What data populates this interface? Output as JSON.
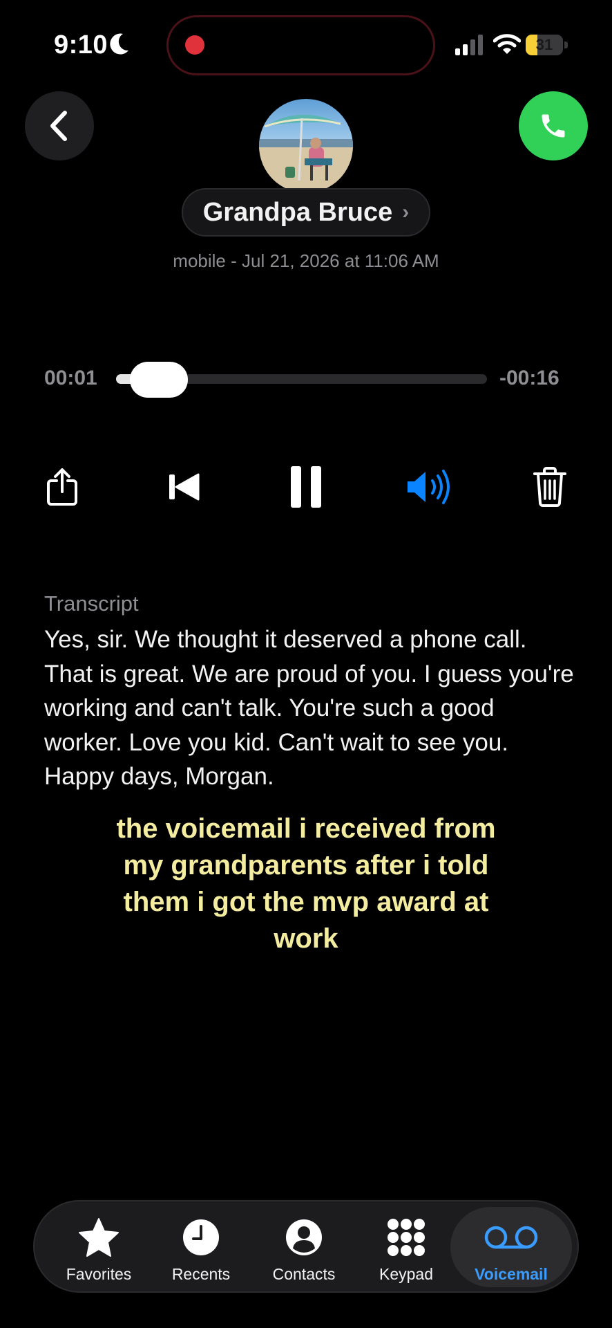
{
  "status_bar": {
    "time": "9:10",
    "battery": "31",
    "battery_level": 0.31,
    "battery_color": "#f7d038",
    "recording_indicator_color": "#e0323a"
  },
  "header": {
    "contact_name": "Grandpa Bruce",
    "subtitle": "mobile - Jul 21, 2026 at 11:06 AM",
    "call_button_color": "#31d158"
  },
  "player": {
    "elapsed": "00:01",
    "remaining": "-00:16",
    "progress": 0.06,
    "controls": [
      "share-icon",
      "skip-back-icon",
      "pause-icon",
      "speaker-icon",
      "trash-icon"
    ],
    "speaker_color": "#0a84ff"
  },
  "transcript": {
    "label": "Transcript",
    "text": "Yes, sir.  We thought it deserved a phone call.  That is great.  We are proud of you.  I guess you're working and can't talk.  You're such a good worker.  Love you kid.  Can't wait to see you.  Happy days, Morgan."
  },
  "caption": {
    "text": "the voicemail i received from my grandparents after i told them i got the mvp award at work",
    "color": "#f4eda0"
  },
  "tabs": [
    {
      "label": "Favorites",
      "icon": "star-icon"
    },
    {
      "label": "Recents",
      "icon": "clock-icon"
    },
    {
      "label": "Contacts",
      "icon": "person-icon"
    },
    {
      "label": "Keypad",
      "icon": "keypad-icon"
    },
    {
      "label": "Voicemail",
      "icon": "voicemail-icon",
      "active": true
    }
  ],
  "active_tab_color": "#3a9cff"
}
